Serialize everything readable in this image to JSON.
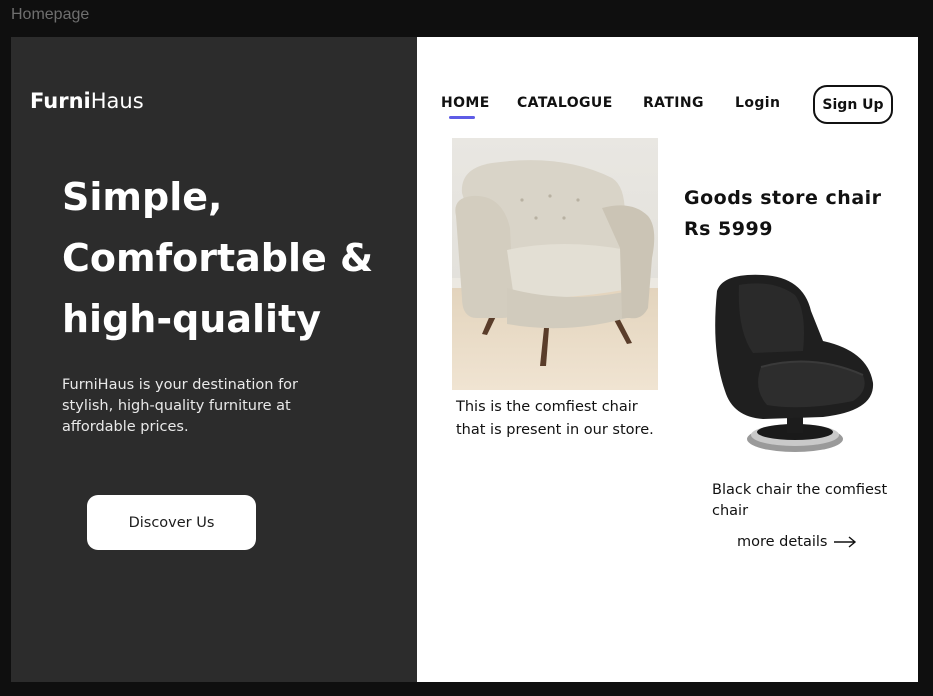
{
  "frame": {
    "label": "Homepage"
  },
  "brand": {
    "bold": "Furni",
    "light": "Haus"
  },
  "hero": {
    "title_lines": [
      "Simple,",
      "Comfortable &",
      "high-quality"
    ],
    "description": "FurniHaus is your destination for stylish, high-quality furniture at affordable prices.",
    "cta_label": "Discover Us"
  },
  "nav": {
    "items": [
      {
        "label": "HOME",
        "active": true
      },
      {
        "label": "CATALOGUE",
        "active": false
      },
      {
        "label": "RATING",
        "active": false
      },
      {
        "label": "Login",
        "active": false
      }
    ],
    "signup_label": "Sign Up"
  },
  "products": {
    "featured": {
      "caption": "This is the comfiest chair that is present in our store."
    },
    "second": {
      "heading": "Goods store chair Rs 5999",
      "caption": "Black chair the comfiest chair",
      "more_label": "more details"
    }
  },
  "colors": {
    "left_panel": "#2c2c2c",
    "right_panel": "#ffffff",
    "accent": "#5e5ce6"
  },
  "icons": {
    "more_details": "arrow-right-icon"
  }
}
